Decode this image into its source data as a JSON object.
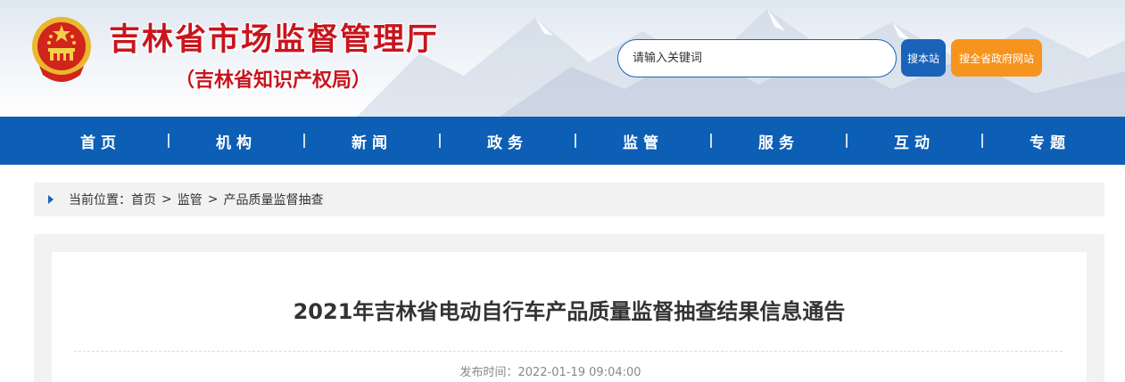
{
  "header": {
    "title": "吉林省市场监督管理厅",
    "subtitle": "（吉林省知识产权局）",
    "emblem_icon": "national-emblem-icon",
    "search": {
      "placeholder": "请输入关键词",
      "site_button": "搜本站",
      "gov_button": "搜全省政府网站"
    },
    "colors": {
      "title": "#c8151d",
      "site_button": "#1a63b8",
      "gov_button": "#f7941d"
    }
  },
  "nav": {
    "color": "#0d5eb5",
    "items": [
      "首页",
      "机构",
      "新闻",
      "政务",
      "监管",
      "服务",
      "互动",
      "专题"
    ]
  },
  "breadcrumb": {
    "prefix": "当前位置：",
    "items": [
      "首页",
      "监管",
      "产品质量监督抽查"
    ],
    "separator": ">"
  },
  "article": {
    "title": "2021年吉林省电动自行车产品质量监督抽查结果信息通告",
    "publish_label": "发布时间：",
    "publish_time": "2022-01-19 09:04:00"
  }
}
